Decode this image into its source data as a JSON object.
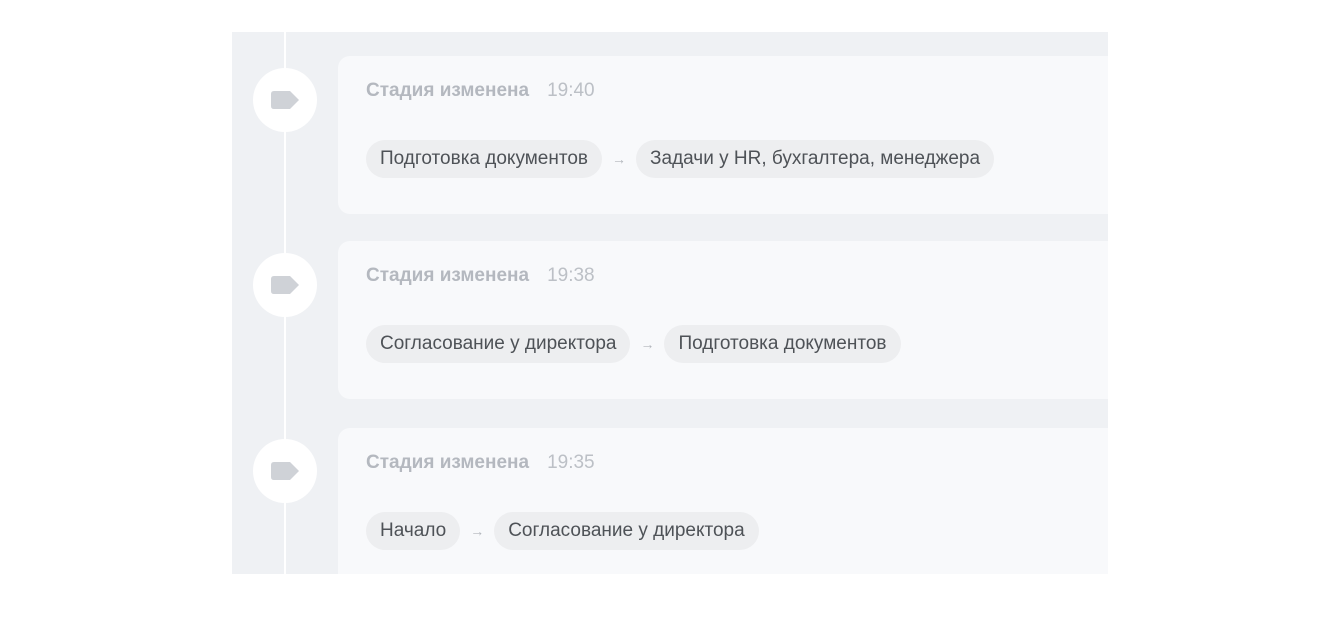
{
  "colors": {
    "panel_background": "#eff1f4",
    "card_background": "#f8f9fb",
    "pill_background": "#edeef0",
    "icon_color": "#cfd2d7"
  },
  "timeline": {
    "arrow_glyph": "→",
    "entries": [
      {
        "icon": "tag-icon",
        "title": "Стадия изменена",
        "time": "19:40",
        "from_stage": "Подготовка документов",
        "to_stage": "Задачи у HR, бухгалтера, менеджера"
      },
      {
        "icon": "tag-icon",
        "title": "Стадия изменена",
        "time": "19:38",
        "from_stage": "Согласование у директора",
        "to_stage": "Подготовка документов"
      },
      {
        "icon": "tag-icon",
        "title": "Стадия изменена",
        "time": "19:35",
        "from_stage": "Начало",
        "to_stage": "Согласование у директора"
      }
    ]
  }
}
